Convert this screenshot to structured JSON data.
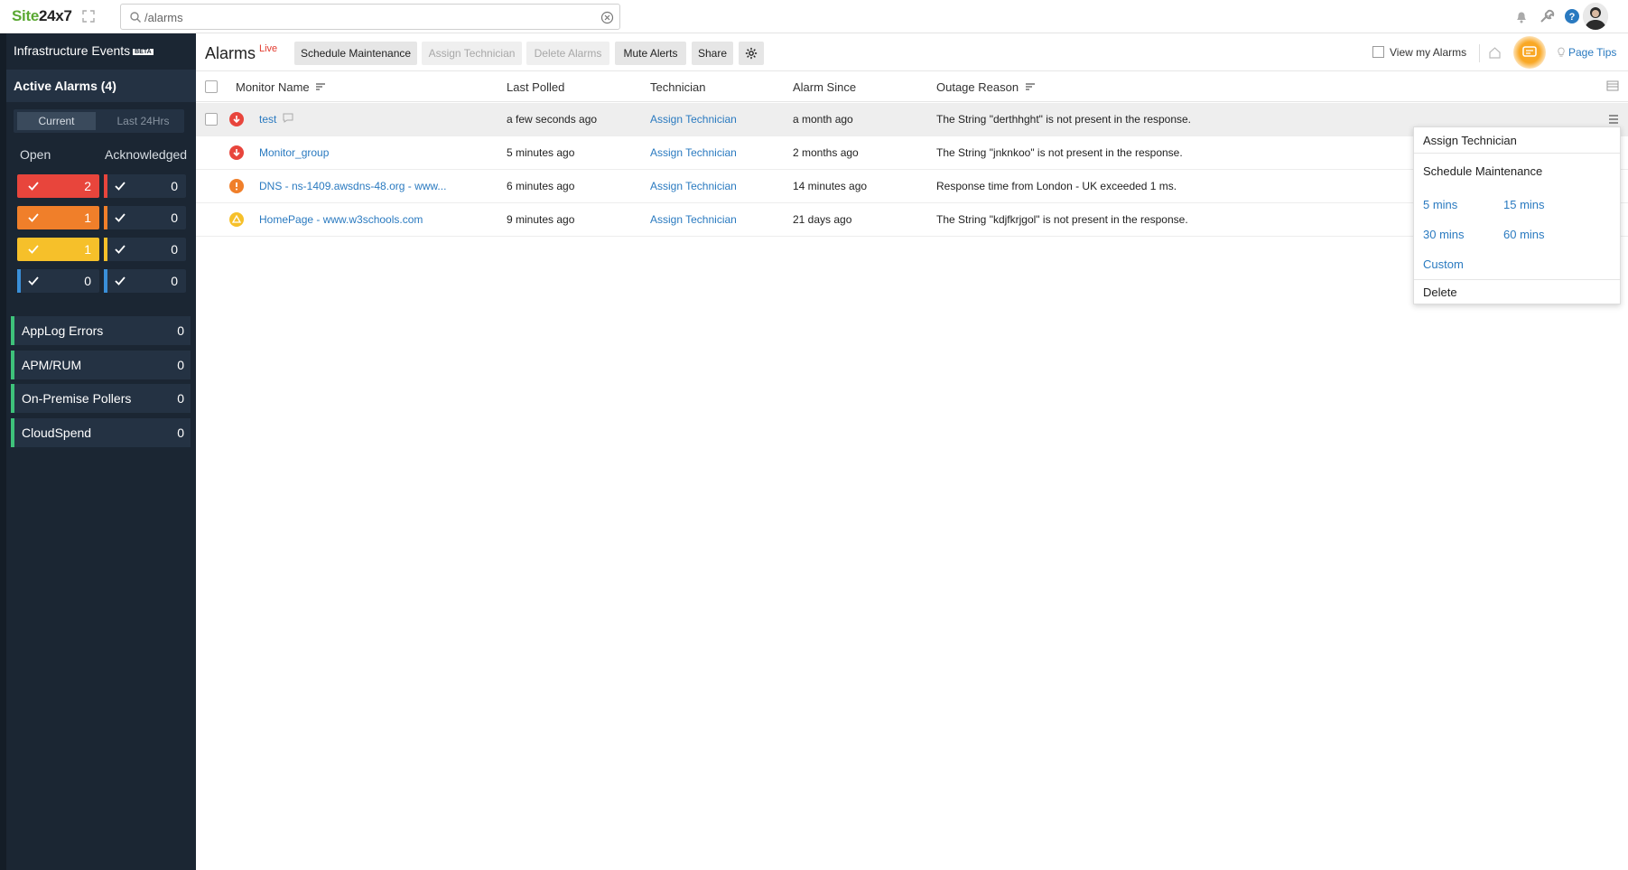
{
  "app": {
    "brand_site": "Site",
    "brand_num": "24x7"
  },
  "search": {
    "value": "/alarms",
    "placeholder": ""
  },
  "sidebar": {
    "title": "Infrastructure Events",
    "beta": "BETA",
    "active_label": "Active Alarms  (4)",
    "segments": {
      "current": "Current",
      "last24": "Last 24Hrs"
    },
    "open_header": "Open",
    "ack_header": "Acknowledged",
    "counts": [
      {
        "color": "#e8453c",
        "open": "2",
        "ack": "0"
      },
      {
        "color": "#f07f2a",
        "open": "1",
        "ack": "0"
      },
      {
        "color": "#f6c02a",
        "open": "1",
        "ack": "0"
      },
      {
        "color": "#3a8fd8",
        "open": "0",
        "ack": "0"
      }
    ],
    "categories": [
      {
        "label": "AppLog Errors",
        "value": "0"
      },
      {
        "label": "APM/RUM",
        "value": "0"
      },
      {
        "label": "On-Premise Pollers",
        "value": "0"
      },
      {
        "label": "CloudSpend",
        "value": "0"
      }
    ]
  },
  "toolbar": {
    "title": "Alarms",
    "live": "Live",
    "schedule": "Schedule Maintenance",
    "assign": "Assign Technician",
    "delete": "Delete Alarms",
    "mute": "Mute Alerts",
    "share": "Share",
    "view_my": "View my Alarms",
    "page_tips": "Page Tips"
  },
  "table": {
    "headers": {
      "monitor": "Monitor Name",
      "polled": "Last Polled",
      "tech": "Technician",
      "since": "Alarm Since",
      "reason": "Outage Reason"
    },
    "rows": [
      {
        "severity": "down",
        "monitor": "test",
        "polled": "a few seconds ago",
        "tech": "Assign Technician",
        "since": "a month ago",
        "reason": "The String \"derthhght\" is not present in the response."
      },
      {
        "severity": "down",
        "monitor": "Monitor_group",
        "polled": "5 minutes ago",
        "tech": "Assign Technician",
        "since": "2 months ago",
        "reason": "The String \"jnknkoo\" is not present in the response."
      },
      {
        "severity": "critical",
        "monitor": "DNS - ns-1409.awsdns-48.org - www...",
        "polled": "6 minutes ago",
        "tech": "Assign Technician",
        "since": "14 minutes ago",
        "reason": "Response time from London - UK exceeded 1 ms."
      },
      {
        "severity": "trouble",
        "monitor": "HomePage - www.w3schools.com",
        "polled": "9 minutes ago",
        "tech": "Assign Technician",
        "since": "21 days ago",
        "reason": "The String \"kdjfkrjgol\" is not present in the response."
      }
    ]
  },
  "dropdown": {
    "assign": "Assign Technician",
    "schedule": "Schedule Maintenance",
    "m5": "5 mins",
    "m15": "15 mins",
    "m30": "30 mins",
    "m60": "60 mins",
    "custom": "Custom",
    "delete": "Delete"
  }
}
